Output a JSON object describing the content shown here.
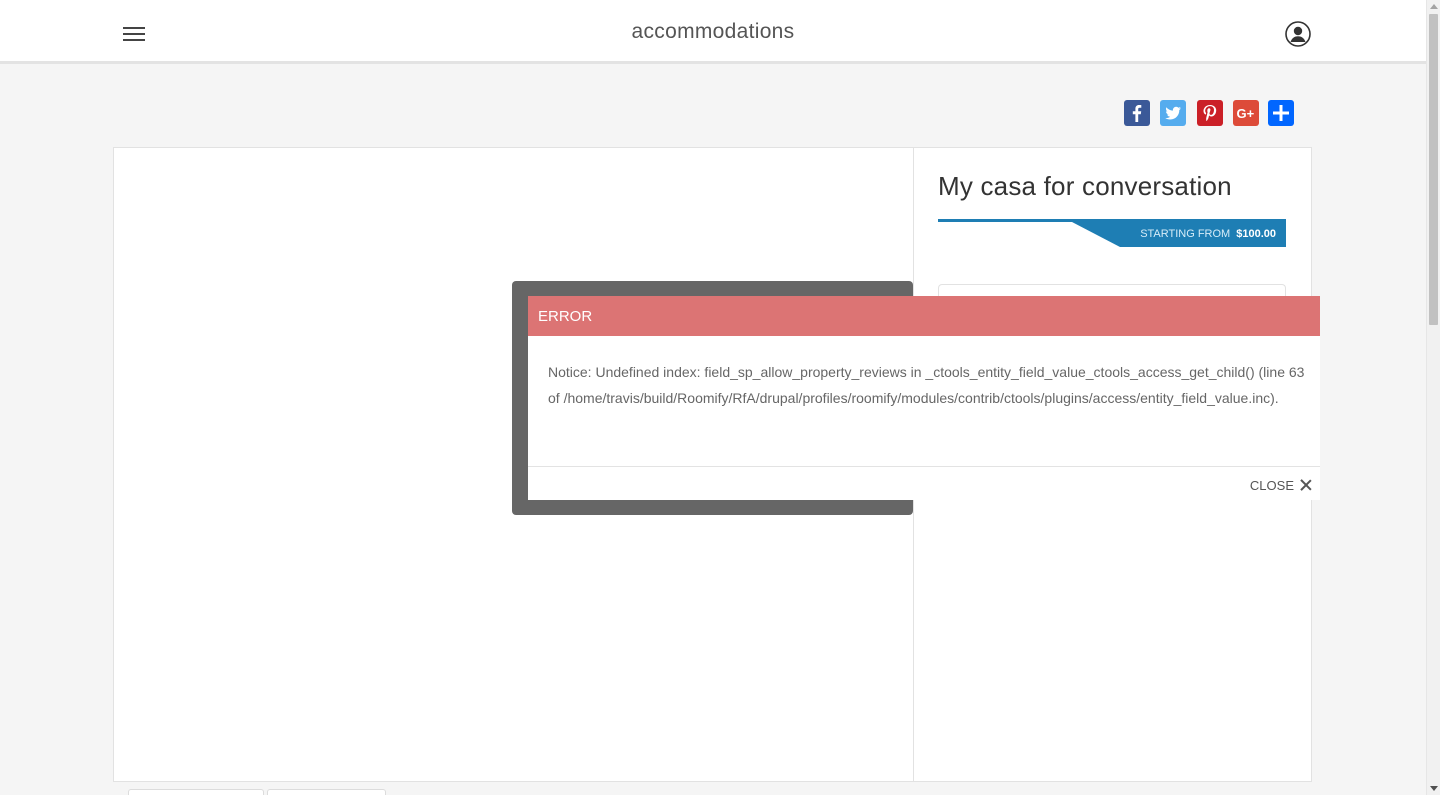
{
  "header": {
    "site_title": "accommodations",
    "menu_icon": "hamburger-menu-icon",
    "user_icon": "user-account-icon"
  },
  "share": [
    {
      "name": "facebook",
      "icon": "facebook-icon",
      "color": "#3b5998"
    },
    {
      "name": "twitter",
      "icon": "twitter-icon",
      "color": "#55acee"
    },
    {
      "name": "pinterest",
      "icon": "pinterest-icon",
      "color": "#cb2027"
    },
    {
      "name": "google-plus",
      "icon": "google-plus-icon",
      "color": "#dd4b39"
    },
    {
      "name": "share",
      "icon": "share-plus-icon",
      "color": "#0166ff"
    }
  ],
  "property": {
    "title": "My casa for conversation",
    "price_label": "STARTING FROM",
    "price_value": "$100.00",
    "accent_color": "#1e7eb4"
  },
  "dialog": {
    "title": "ERROR",
    "message": "Notice: Undefined index: field_sp_allow_property_reviews in _ctools_entity_field_value_ctools_access_get_child() (line 63 of /home/travis/build/Roomify/RfA/drupal/profiles/roomify/modules/contrib/ctools/plugins/access/entity_field_value.inc).",
    "close_label": "CLOSE",
    "header_color": "#dc7474"
  }
}
